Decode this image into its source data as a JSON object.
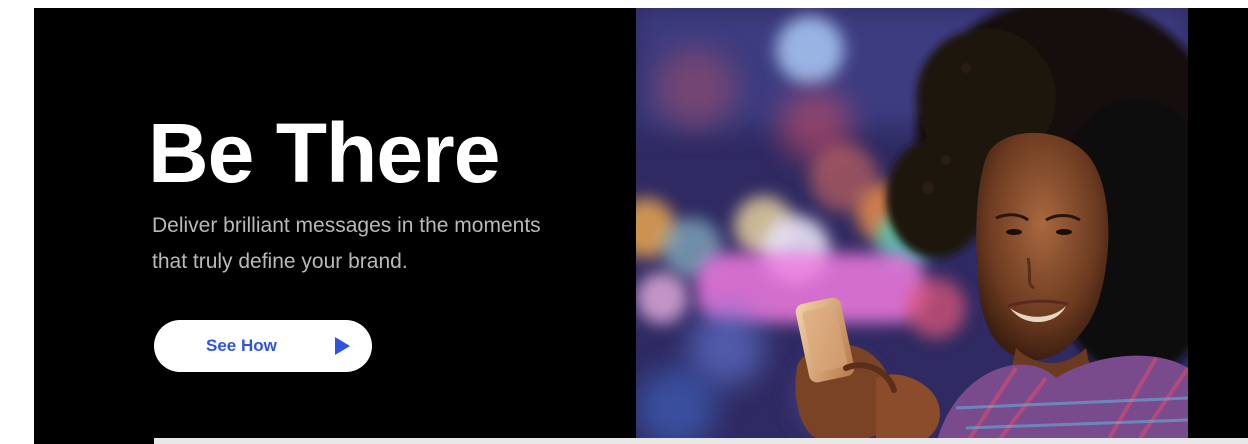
{
  "hero": {
    "headline": "Be There",
    "subtext_line1": "Deliver brilliant messages in the moments",
    "subtext_line2": "that truly define your brand.",
    "cta_label": "See How",
    "cta_icon": "play-triangle-icon"
  },
  "colors": {
    "background": "#000000",
    "headline": "#ffffff",
    "subtext": "#b9b9b9",
    "cta_background": "#ffffff",
    "cta_accent": "#2f55e0"
  }
}
